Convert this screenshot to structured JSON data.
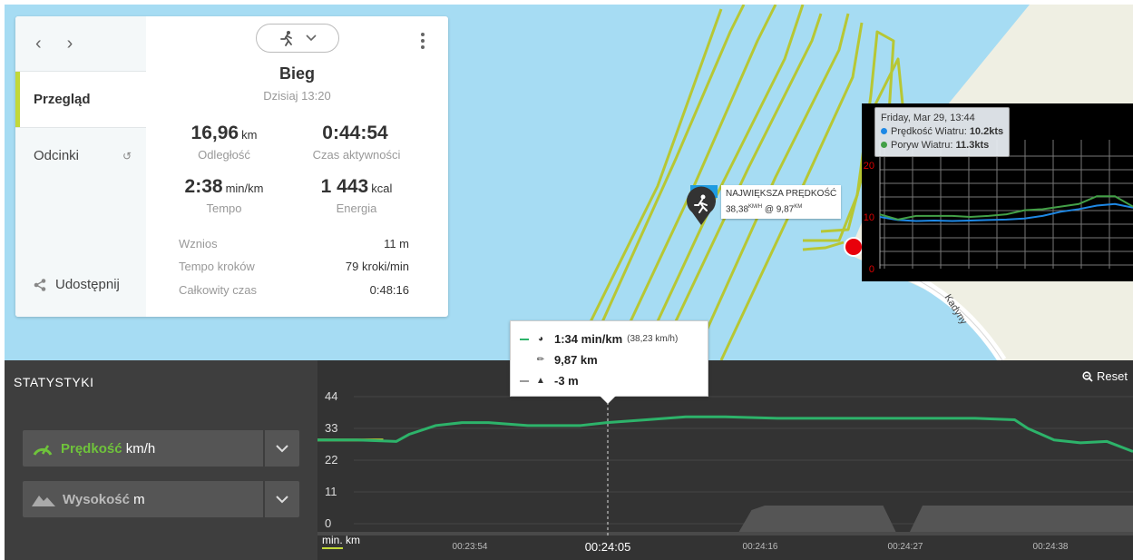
{
  "card": {
    "nav": {
      "prev_icon": "chevron-left-icon",
      "next_icon": "chevron-right-icon"
    },
    "side": [
      {
        "label": "Przegląd",
        "active": true
      },
      {
        "label": "Odcinki",
        "active": false
      }
    ],
    "share_label": "Udostępnij",
    "activity_title": "Bieg",
    "activity_date": "Dzisiaj 13:20",
    "stats": [
      {
        "value": "16,96",
        "unit": "km",
        "label": "Odległość"
      },
      {
        "value": "0:44:54",
        "unit": "",
        "label": "Czas aktywności"
      },
      {
        "value": "2:38",
        "unit": "min/km",
        "label": "Tempo"
      },
      {
        "value": "1 443",
        "unit": "kcal",
        "label": "Energia"
      }
    ],
    "details": [
      {
        "key": "Wznios",
        "value": "11 m"
      },
      {
        "key": "Tempo kroków",
        "value": "79 kroki/min"
      },
      {
        "key": "Całkowity czas",
        "value": "0:48:16"
      }
    ]
  },
  "map": {
    "road_label": "Kadyny",
    "max_speed_title": "NAJWIĘKSZA PRĘDKOŚĆ",
    "max_speed_value": "38,38",
    "max_speed_unit": "KM/H",
    "max_speed_at": "@ 9,87",
    "max_speed_at_unit": "KM"
  },
  "wind": {
    "tooltip_date": "Friday, Mar 29, 13:44",
    "series": [
      {
        "label": "Prędkość Wiatru:",
        "value": "10.2kts",
        "color": "#1e88e5"
      },
      {
        "label": "Poryw Wiatru:",
        "value": "11.3kts",
        "color": "#43a047"
      }
    ],
    "y_ticks": [
      "20",
      "10",
      "0"
    ],
    "chart_data": {
      "type": "line",
      "ylim": [
        0,
        20
      ],
      "series": [
        {
          "name": "Prędkość Wiatru",
          "values": [
            10,
            9.4,
            9.2,
            9.3,
            9.2,
            9.3,
            9.4,
            9.5,
            9.7,
            10.2,
            11,
            11.5,
            12.2,
            12.5,
            11.8
          ]
        },
        {
          "name": "Poryw Wiatru",
          "values": [
            10.5,
            9.5,
            10.2,
            10.2,
            10.2,
            10,
            10.2,
            10.5,
            11.3,
            11.5,
            12,
            12.5,
            14,
            14,
            12
          ]
        }
      ]
    }
  },
  "stats_panel": {
    "title": "STATYSTYKI",
    "reset_label": "Reset",
    "metrics": [
      {
        "name": "Prędkość",
        "unit": "km/h",
        "icon": "speedometer-icon",
        "color": "#6fc33b"
      },
      {
        "name": "Wysokość",
        "unit": "m",
        "icon": "mountain-icon",
        "color": "#aaaaaa"
      }
    ],
    "unit_toggle": {
      "primary": "min.",
      "secondary": "km"
    },
    "tooltip": {
      "pace": "1:34 min/km",
      "speed_paren": "(38,23 km/h)",
      "distance": "9,87 km",
      "altitude": "-3 m"
    },
    "chart_data": {
      "type": "line",
      "y_ticks": [
        "44",
        "33",
        "22",
        "11",
        "0"
      ],
      "ylim": [
        0,
        44
      ],
      "x_ticks": [
        "00:23:54",
        "00:24:05",
        "00:24:16",
        "00:24:27",
        "00:24:38"
      ],
      "highlight_x": "00:24:05",
      "series": [
        {
          "name": "Prędkość",
          "color": "#2db36a",
          "x_sec": [
            0,
            3,
            6,
            7,
            9,
            11,
            13,
            16,
            20,
            22,
            25,
            28,
            31,
            35,
            40,
            44,
            47,
            50,
            53,
            54,
            56,
            58,
            60,
            62
          ],
          "values": [
            29,
            29,
            28.5,
            31,
            34,
            35,
            35,
            34,
            34,
            35,
            36,
            37,
            37,
            36.5,
            36.5,
            36.5,
            36.5,
            36.5,
            36,
            33,
            29,
            28,
            28.5,
            25
          ]
        },
        {
          "name": "Wysokość",
          "color": "#555555",
          "x_sec": [
            0,
            32,
            33,
            34,
            43,
            44,
            45,
            46,
            47,
            62
          ],
          "values": [
            0,
            0,
            5,
            6,
            6,
            0,
            0,
            6,
            6,
            6
          ]
        }
      ]
    }
  }
}
